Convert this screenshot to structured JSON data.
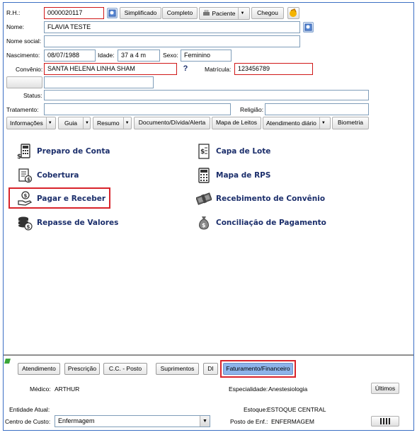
{
  "patient": {
    "rh_label": "R.H.:",
    "rh_value": "0000020117",
    "nome_label": "Nome:",
    "nome_value": "FLAVIA TESTE",
    "nome_social_label": "Nome social:",
    "nome_social_value": "",
    "nascimento_label": "Nascimento:",
    "nascimento_value": "08/07/1988",
    "idade_label": "Idade:",
    "idade_value": "37 a 4 m",
    "sexo_label": "Sexo:",
    "sexo_value": "Feminino",
    "convenio_label": "Convênio:",
    "convenio_value": "SANTA HELENA LINHA SHAM",
    "convenio_help": "?",
    "matricula_label": "Matrícula:",
    "matricula_value": "123456789",
    "status_label": "Status:",
    "status_value": "",
    "tratamento_label": "Tratamento:",
    "tratamento_value": "",
    "religiao_label": "Religião:",
    "religiao_value": ""
  },
  "header_buttons": {
    "simplificado": "Simplificado",
    "completo": "Completo",
    "paciente": "Paciente",
    "chegou": "Chegou"
  },
  "nav_tabs": {
    "informacoes": "Informações",
    "guia": "Guia",
    "resumo": "Resumo",
    "documento": "Documento/Dívida/Alerta",
    "mapa_leitos": "Mapa de Leitos",
    "atendimento_diario": "Atendimento diário",
    "biometria": "Biometria"
  },
  "menu": {
    "left": [
      "Preparo de Conta",
      "Cobertura",
      "Pagar e Receber",
      "Repasse de Valores"
    ],
    "right": [
      "Capa de Lote",
      "Mapa de RPS",
      "Recebimento de Convênio",
      "Conciliação de Pagamento"
    ],
    "left_icons": [
      "calculator-money-icon",
      "coverage-checklist-icon",
      "hand-coin-icon",
      "coin-stack-icon"
    ],
    "right_icons": [
      "document-money-icon",
      "calculator-icon",
      "money-bundle-icon",
      "money-bag-icon"
    ]
  },
  "bottom_tabs": {
    "atendimento": "Atendimento",
    "prescricao": "Prescrição",
    "cc_posto": "C.C. - Posto",
    "suprimentos": "Suprimentos",
    "di": "DI",
    "faturamento": "Faturamento/Financeiro"
  },
  "footer": {
    "medico_label": "Médico:",
    "medico_value": "ARTHUR",
    "especialidade_label": "Especialidade:",
    "especialidade_value": "Anestesiologia",
    "ultimos": "Últimos",
    "entidade_label": "Entidade Atual:",
    "entidade_value": "",
    "estoque_label": "Estoque:",
    "estoque_value": "ESTOQUE CENTRAL",
    "centro_custo_label": "Centro de Custo:",
    "centro_custo_value": "Enfermagem",
    "posto_label": "Posto de Enf.:",
    "posto_value": "ENFERMAGEM"
  },
  "colors": {
    "frame_border": "#3c6fc4",
    "menu_text": "#1b2e6b",
    "highlight": "#d8232a",
    "active_tab": "#8eb4ea"
  }
}
